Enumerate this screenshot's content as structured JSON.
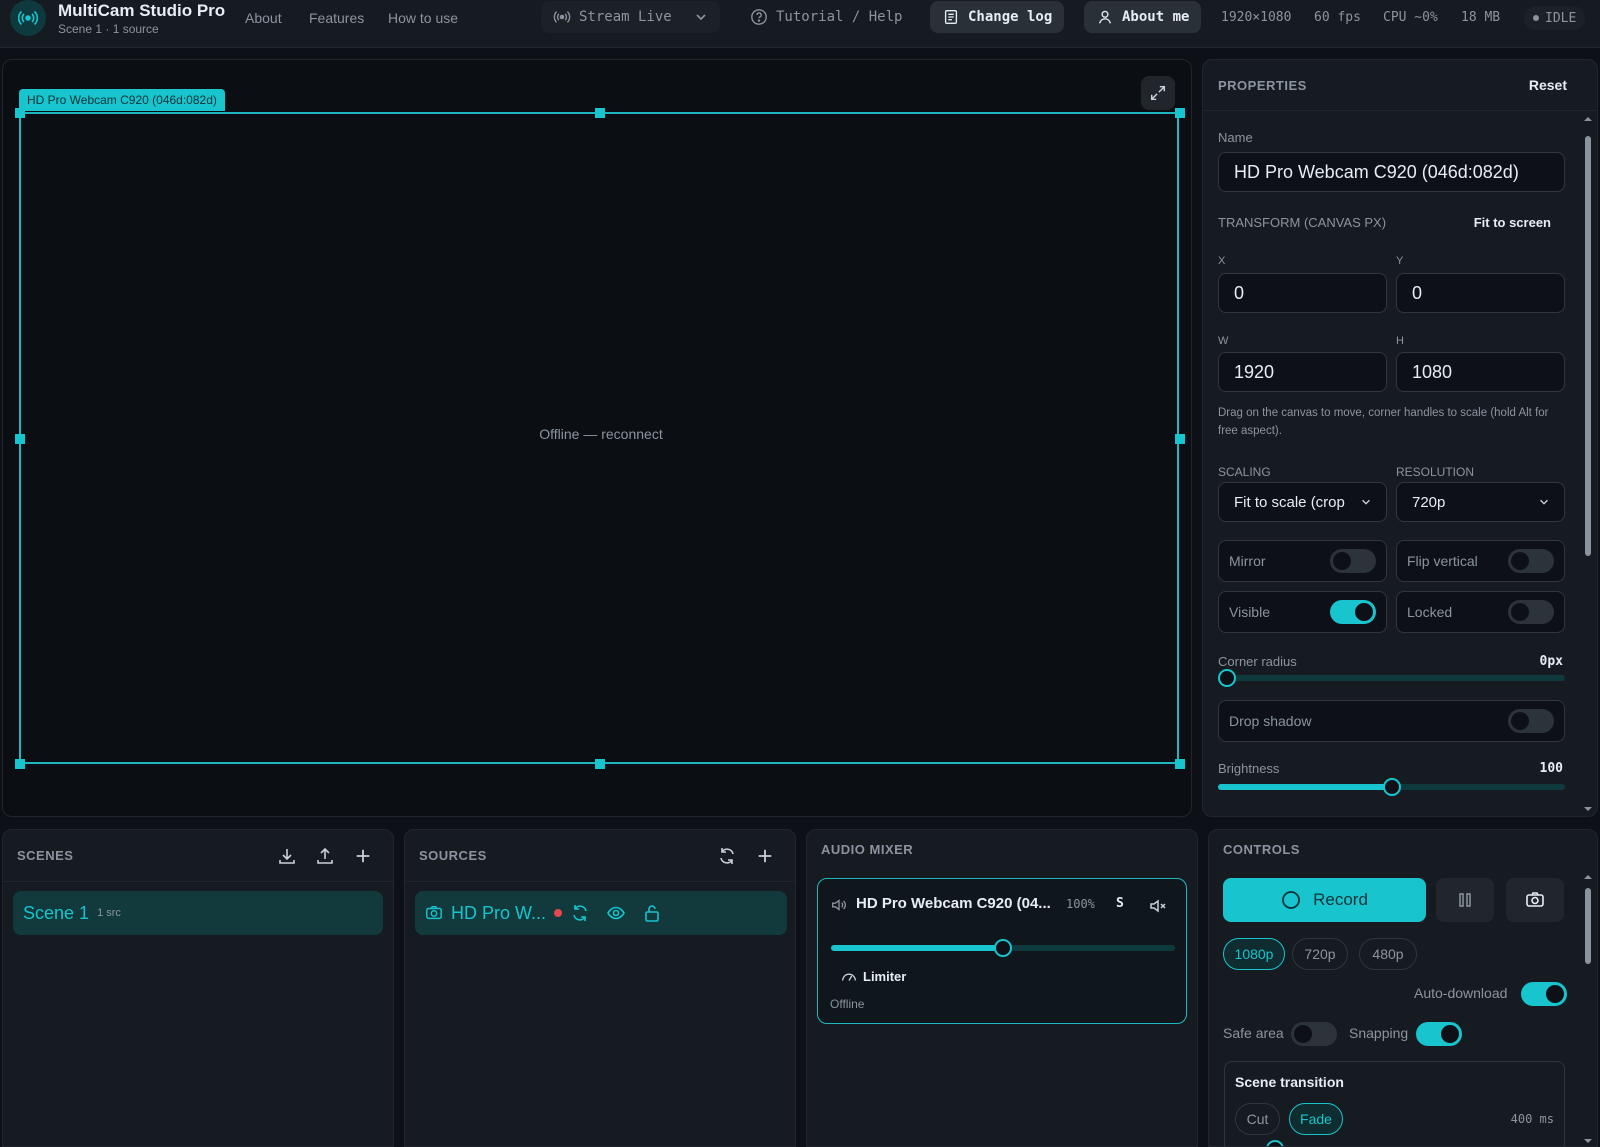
{
  "app": {
    "title": "MultiCam Studio Pro",
    "subtitle": "Scene 1 · 1 source",
    "nav": [
      "About",
      "Features",
      "How to use"
    ]
  },
  "toolbar": {
    "stream_label": "Stream Live",
    "tutorial_label": "Tutorial / Help",
    "changelog_label": "Change log",
    "about_label": "About me",
    "resolution": "1920×1080",
    "fps": "60 fps",
    "cpu": "CPU ~0%",
    "memory": "18 MB",
    "status": "IDLE"
  },
  "canvas": {
    "source_tag": "HD Pro Webcam C920 (046d:082d)",
    "message": "Offline — reconnect"
  },
  "properties": {
    "title": "PROPERTIES",
    "reset_label": "Reset",
    "name_label": "Name",
    "name_value": "HD Pro Webcam C920 (046d:082d)",
    "transform_label": "TRANSFORM (CANVAS PX)",
    "fit_label": "Fit to screen",
    "x_label": "X",
    "x_value": "0",
    "y_label": "Y",
    "y_value": "0",
    "w_label": "W",
    "w_value": "1920",
    "h_label": "H",
    "h_value": "1080",
    "hint": "Drag on the canvas to move, corner handles to scale (hold Alt for free aspect).",
    "scaling_label": "SCALING",
    "scaling_value": "Fit to scale (crop",
    "resolution_label": "RESOLUTION",
    "resolution_value": "720p",
    "mirror_label": "Mirror",
    "mirror_on": false,
    "flip_label": "Flip vertical",
    "flip_on": false,
    "visible_label": "Visible",
    "visible_on": true,
    "locked_label": "Locked",
    "locked_on": false,
    "radius_label": "Corner radius",
    "radius_value": "0px",
    "radius_fraction": 0,
    "shadow_label": "Drop shadow",
    "shadow_on": false,
    "brightness_label": "Brightness",
    "brightness_value": "100",
    "brightness_fraction": 0.5
  },
  "scenes": {
    "title": "SCENES",
    "items": [
      {
        "name": "Scene 1",
        "count": "1 src"
      }
    ]
  },
  "sources": {
    "title": "SOURCES",
    "items": [
      {
        "name": "HD Pro W..."
      }
    ]
  },
  "mixer": {
    "title": "AUDIO MIXER",
    "channel_name": "HD Pro Webcam C920 (04...",
    "volume": "100%",
    "solo_label": "S",
    "volume_fraction": 0.5,
    "limiter_label": "Limiter",
    "status": "Offline"
  },
  "controls": {
    "title": "CONTROLS",
    "record_label": "Record",
    "resolutions": [
      "1080p",
      "720p",
      "480p"
    ],
    "active_resolution": "1080p",
    "auto_download_label": "Auto-download",
    "safe_area_label": "Safe area",
    "snapping_label": "Snapping",
    "transition_title": "Scene transition",
    "transitions": [
      "Cut",
      "Fade"
    ],
    "active_transition": "Fade",
    "transition_ms": "400 ms"
  },
  "colors": {
    "accent": "#18c4cd",
    "background": "#0d1117",
    "panel": "#161b22",
    "live_dot": "#e5484d"
  }
}
